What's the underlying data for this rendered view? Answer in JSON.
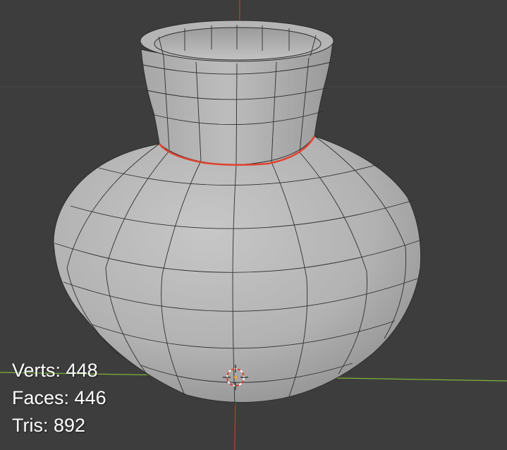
{
  "viewport": {
    "background": "#3d3d3d",
    "x_axis_color": "#7fb13a",
    "y_axis_color": "#c0392b",
    "selected_edge_color": "#e0412f",
    "mesh_color": "#b8b8b8",
    "wire_color": "#2e2e2e",
    "cursor_icon": "3d-cursor-icon"
  },
  "stats": {
    "verts_label": "Verts:",
    "verts_value": "448",
    "faces_label": "Faces:",
    "faces_value": "446",
    "tris_label": "Tris:",
    "tris_value": "892"
  }
}
